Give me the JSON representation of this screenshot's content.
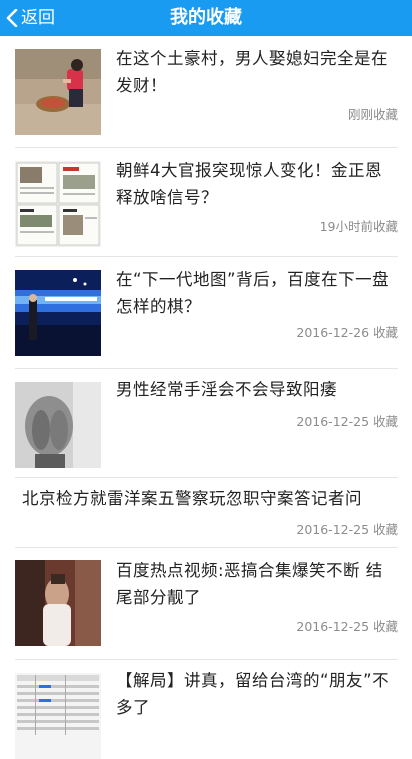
{
  "header": {
    "back_label": "返回",
    "title": "我的收藏"
  },
  "items": [
    {
      "title": "在这个土豪村，男人娶媳妇完全是在发财！",
      "time": "刚刚收藏",
      "thumb": "woman-with-money-basin"
    },
    {
      "title": "朝鲜4大官报突现惊人变化！金正恩释放啥信号？",
      "time": "19小时前收藏",
      "thumb": "newspaper-pages"
    },
    {
      "title": "在“下一代地图”背后，百度在下一盘怎样的棋？",
      "time": "2016-12-26 收藏",
      "thumb": "stage-presentation"
    },
    {
      "title": "男性经常手淫会不会导致阳痿",
      "time": "2016-12-25 收藏",
      "thumb": "man-covering-face"
    },
    {
      "title": "北京检方就雷洋案五警察玩忽职守案答记者问",
      "time": "2016-12-25 收藏",
      "thumb": ""
    },
    {
      "title": "百度热点视频:恶搞合集爆笑不断 结尾部分靓了",
      "time": "2016-12-25 收藏",
      "thumb": "blurred-girl"
    },
    {
      "title": "【解局】讲真，留给台湾的“朋友”不多了",
      "time": "",
      "thumb": "data-table"
    }
  ]
}
